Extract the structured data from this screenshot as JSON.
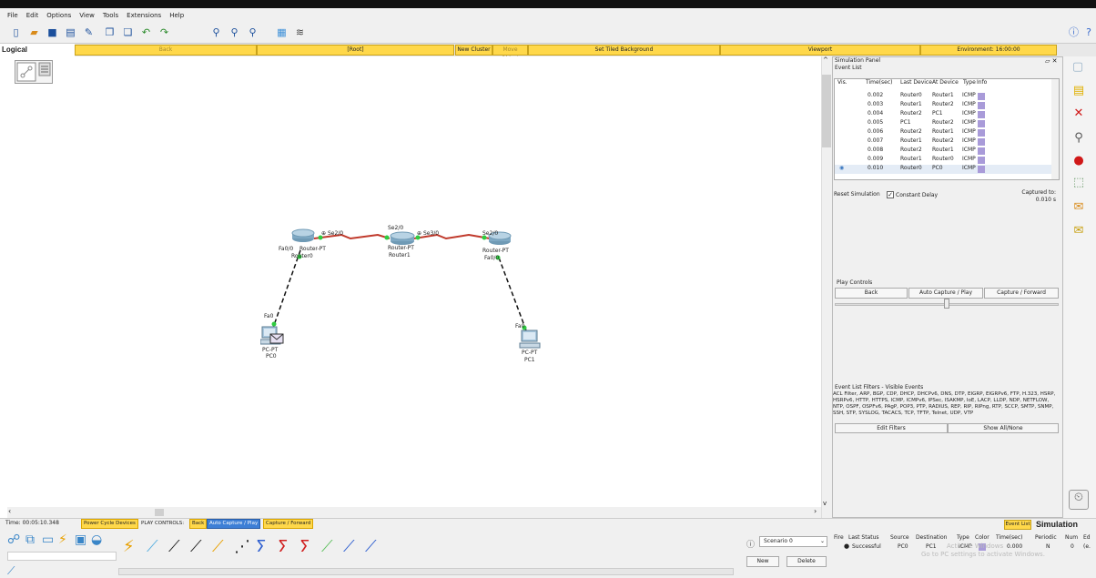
{
  "menu": [
    "File",
    "Edit",
    "Options",
    "View",
    "Tools",
    "Extensions",
    "Help"
  ],
  "toolbar_icons": [
    "new-icon",
    "open-icon",
    "save-icon",
    "print-icon",
    "activity-wizard-icon",
    "copy-icon",
    "paste-icon",
    "undo-icon",
    "redo-icon",
    "zoom-in-icon",
    "zoom-reset-icon",
    "zoom-out-icon",
    "palette-icon",
    "custom-device-icon"
  ],
  "logical_bar": {
    "title": "Logical",
    "back": "Back",
    "root": "[Root]",
    "new_cluster": "New Cluster",
    "move_object": "Move Object",
    "tiled_bg": "Set Tiled Background",
    "viewport": "Viewport",
    "environment": "Environment: 16:00:00"
  },
  "topology": {
    "router0": {
      "model": "Router-PT",
      "name": "Router0",
      "port_fa": "Fa0/0",
      "port_se": "Se2/0"
    },
    "router1": {
      "model": "Router-PT",
      "name": "Router1",
      "port_left": "Se2/0",
      "port_right": "Se3/0"
    },
    "router2": {
      "model": "Router-PT",
      "name": "Router2",
      "port_se": "Se2/0",
      "port_fa": "Fa0/0"
    },
    "pc0": {
      "model": "PC-PT",
      "name": "PC0",
      "port": "Fa0"
    },
    "pc1": {
      "model": "PC-PT",
      "name": "PC1",
      "port": "Fa0"
    }
  },
  "sim_panel": {
    "title": "Simulation Panel",
    "event_list_label": "Event List",
    "headers": {
      "vis": "Vis.",
      "time": "Time(sec)",
      "last": "Last Device",
      "at": "At Device",
      "type": "Type",
      "info": "Info"
    },
    "events": [
      {
        "time": "0.002",
        "last": "Router0",
        "at": "Router1",
        "type": "ICMP"
      },
      {
        "time": "0.003",
        "last": "Router1",
        "at": "Router2",
        "type": "ICMP"
      },
      {
        "time": "0.004",
        "last": "Router2",
        "at": "PC1",
        "type": "ICMP"
      },
      {
        "time": "0.005",
        "last": "PC1",
        "at": "Router2",
        "type": "ICMP"
      },
      {
        "time": "0.006",
        "last": "Router2",
        "at": "Router1",
        "type": "ICMP"
      },
      {
        "time": "0.007",
        "last": "Router1",
        "at": "Router2",
        "type": "ICMP"
      },
      {
        "time": "0.008",
        "last": "Router2",
        "at": "Router1",
        "type": "ICMP"
      },
      {
        "time": "0.009",
        "last": "Router1",
        "at": "Router0",
        "type": "ICMP"
      },
      {
        "time": "0.010",
        "last": "Router0",
        "at": "PC0",
        "type": "ICMP"
      }
    ],
    "info_color": "#a99bd9",
    "reset": "Reset Simulation",
    "constant_delay": "Constant Delay",
    "captured_label": "Captured to:",
    "captured_value": "0.010 s",
    "play_controls": "Play Controls",
    "back": "Back",
    "auto_capture": "Auto Capture / Play",
    "capture_forward": "Capture / Forward",
    "filters_label": "Event List Filters - Visible Events",
    "filters_text": "ACL Filter, ARP, BGP, CDP, DHCP, DHCPv6, DNS, DTP, EIGRP, EIGRPv6, FTP, H.323, HSRP, HSRPv6, HTTP, HTTPS, ICMP, ICMPv6, IPSec, ISAKMP, IoE, LACP, LLDP, NDP, NETFLOW, NTP, OSPF, OSPFv6, PAgP, POP3, PTP, RADIUS, REP, RIP, RIPng, RTP, SCCP, SMTP, SNMP, SSH, STP, SYSLOG, TACACS, TCP, TFTP, Telnet, UDP, VTP",
    "edit_filters": "Edit Filters",
    "show_all": "Show All/None"
  },
  "status": {
    "time": "Time: 00:05:10.348",
    "power_cycle": "Power Cycle Devices",
    "play_controls": "PLAY CONTROLS:",
    "back": "Back",
    "auto_capture": "Auto Capture / Play",
    "capture_forward": "Capture / Forward",
    "event_list": "Event List",
    "mode": "Simulation"
  },
  "scenario": {
    "selected": "Scenario 0",
    "new": "New",
    "delete": "Delete"
  },
  "pdu_table": {
    "headers": [
      "Fire",
      "Last Status",
      "Source",
      "Destination",
      "Type",
      "Color",
      "Time(sec)",
      "Periodic",
      "Num",
      "Ed"
    ],
    "row": [
      "Successful",
      "PC0",
      "PC1",
      "ICMP",
      "",
      "0.000",
      "N",
      "0",
      "(e."
    ],
    "row_color": "#a99bd9"
  },
  "watermark": {
    "line1": "Activate Windows",
    "line2": "Go to PC settings to activate Windows."
  },
  "colors": {
    "serial_link": "#c0392b",
    "ethernet_link": "#111111",
    "link_up": "#2ecc40",
    "accent_yellow": "#ffd84a"
  }
}
